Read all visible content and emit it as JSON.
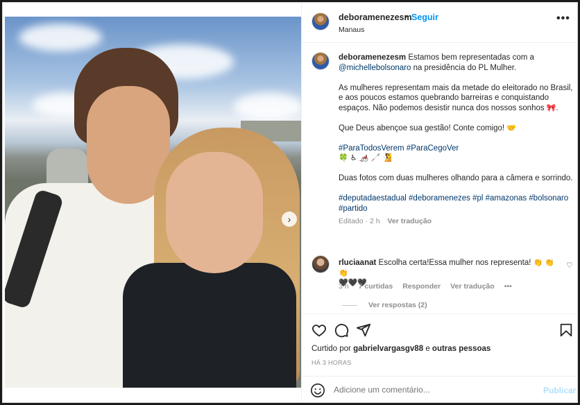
{
  "header": {
    "username": "deboramenezesm",
    "separator": "•",
    "follow_label": "Seguir",
    "location": "Manaus",
    "more_icon": "more-horizontal-icon"
  },
  "caption": {
    "username": "deboramenezesm",
    "line1": "Estamos bem representadas com a",
    "mention": "@michellebolsonaro",
    "line1_tail": " na presidência do PL Mulher.",
    "para2": "As mulheres representam mais da metade do eleitorado no Brasil, e aos poucos estamos quebrando barreiras e conquistando espaços. Não podemos desistir nunca dos nossos sonhos",
    "para2_emoji": "🎀.",
    "para3": "Que Deus abençoe sua gestão! Conte comigo!",
    "para3_emoji": "🤝",
    "hashtags_access": "#ParaTodosVerem #ParaCegoVer",
    "access_emojis": "🍀 ♿ 🦽 🦯 🧏",
    "para5": "Duas fotos com duas mulheres olhando para a câmera e sorrindo.",
    "hashtags": "#deputadaestadual #deboramenezes #pl #amazonas #bolsonaro #partido",
    "meta_edited": "Editado · 2 h",
    "meta_translate": "Ver tradução"
  },
  "comment": {
    "username": "rluciaanat",
    "text": "Escolha certa!Essa mulher nos representa!",
    "emojis": "👏 👏 👏",
    "hearts": "🖤🖤🖤",
    "time": "3 h",
    "likes": "7 curtidas",
    "reply": "Responder",
    "translate": "Ver tradução",
    "more": "•••",
    "view_replies": "Ver respostas (2)"
  },
  "actions": {
    "like_icon": "heart-icon",
    "comment_icon": "comment-icon",
    "share_icon": "send-icon",
    "save_icon": "bookmark-icon"
  },
  "likes": {
    "prefix": "Curtido por",
    "user": "gabrielvargasgv88",
    "middle": "e",
    "suffix": "outras pessoas"
  },
  "timestamp": "HÁ 3 HORAS",
  "add_comment": {
    "placeholder": "Adicione um comentário...",
    "publish_label": "Publicar"
  },
  "carousel": {
    "next_arrow": "›"
  },
  "colors": {
    "link_blue": "#0095f6",
    "hashtag_blue": "#00376b",
    "muted": "#8e8e8e"
  }
}
